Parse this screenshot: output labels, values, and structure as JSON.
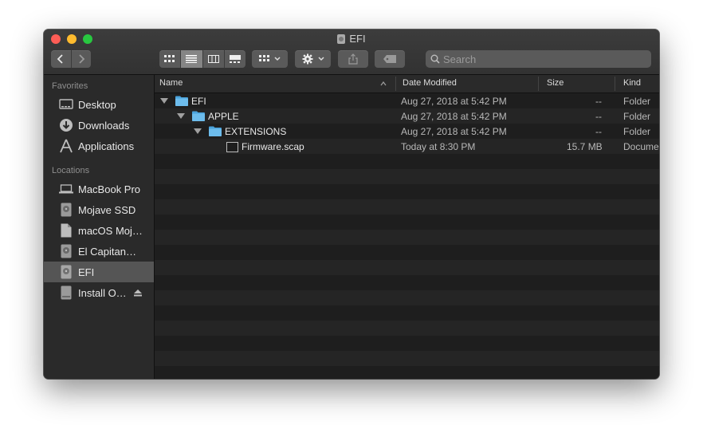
{
  "window": {
    "title": "EFI"
  },
  "toolbar": {
    "back_icon": "chevron-left-icon",
    "forward_icon": "chevron-right-icon",
    "view_modes": [
      "icon-view",
      "list-view",
      "column-view",
      "gallery-view"
    ],
    "active_view": "list-view",
    "group_icon": "group-grid-icon",
    "action_icon": "gear-icon",
    "share_icon": "share-icon",
    "tags_icon": "tag-icon",
    "search_placeholder": "Search"
  },
  "sidebar": {
    "favorites_header": "Favorites",
    "favorites": [
      {
        "label": "Desktop",
        "icon": "desktop-icon"
      },
      {
        "label": "Downloads",
        "icon": "downloads-icon"
      },
      {
        "label": "Applications",
        "icon": "applications-icon"
      }
    ],
    "locations_header": "Locations",
    "locations": [
      {
        "label": "MacBook Pro",
        "icon": "laptop-icon"
      },
      {
        "label": "Mojave SSD",
        "icon": "disk-icon"
      },
      {
        "label": "macOS Moj…",
        "icon": "document-icon"
      },
      {
        "label": "El Capitan…",
        "icon": "disk-icon"
      },
      {
        "label": "EFI",
        "icon": "disk-icon",
        "selected": true
      },
      {
        "label": "Install O…",
        "icon": "external-disk-icon",
        "ejectable": true
      }
    ]
  },
  "columns": {
    "name": "Name",
    "date": "Date Modified",
    "size": "Size",
    "kind": "Kind"
  },
  "files": [
    {
      "name": "EFI",
      "date": "Aug 27, 2018 at 5:42 PM",
      "size": "--",
      "kind": "Folder",
      "level": 0,
      "type": "folder",
      "expanded": true
    },
    {
      "name": "APPLE",
      "date": "Aug 27, 2018 at 5:42 PM",
      "size": "--",
      "kind": "Folder",
      "level": 1,
      "type": "folder",
      "expanded": true
    },
    {
      "name": "EXTENSIONS",
      "date": "Aug 27, 2018 at 5:42 PM",
      "size": "--",
      "kind": "Folder",
      "level": 2,
      "type": "folder",
      "expanded": true
    },
    {
      "name": "Firmware.scap",
      "date": "Today at 8:30 PM",
      "size": "15.7 MB",
      "kind": "Document",
      "level": 3,
      "type": "file"
    }
  ],
  "colors": {
    "folder": "#5fb3e8",
    "selection": "#555555",
    "accent_close": "#fd5d56",
    "accent_min": "#febb2e",
    "accent_max": "#28c840"
  }
}
